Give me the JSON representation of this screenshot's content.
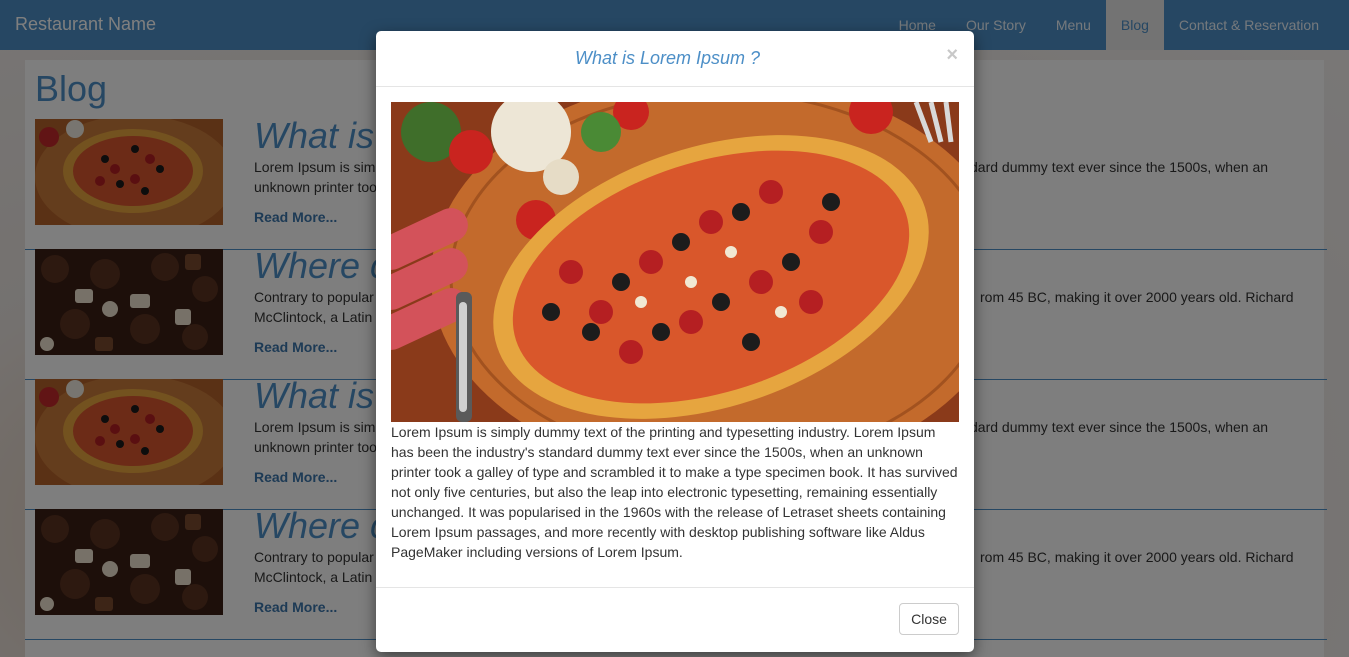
{
  "navbar": {
    "brand": "Restaurant Name",
    "items": [
      {
        "label": "Home",
        "active": false
      },
      {
        "label": "Our Story",
        "active": false
      },
      {
        "label": "Menu",
        "active": false
      },
      {
        "label": "Blog",
        "active": true
      },
      {
        "label": "Contact & Reservation",
        "active": false
      }
    ]
  },
  "page": {
    "title": "Blog",
    "posts": [
      {
        "image": "pizza-image",
        "title": "What is",
        "excerpt_left": "Lorem Ipsum is sim",
        "excerpt_right": "dard dummy text ever since the 1500s, when an",
        "excerpt_line2": "unknown printer too",
        "read_more": "Read More..."
      },
      {
        "image": "chocolates-image",
        "title": "Where c",
        "excerpt_left": "Contrary to popular",
        "excerpt_right": "rom 45 BC, making it over 2000 years old. Richard",
        "excerpt_line2": "McClintock, a Latin",
        "read_more": "Read More..."
      },
      {
        "image": "pizza-image",
        "title": "What is",
        "excerpt_left": "Lorem Ipsum is sim",
        "excerpt_right": "dard dummy text ever since the 1500s, when an",
        "excerpt_line2": "unknown printer too",
        "read_more": "Read More..."
      },
      {
        "image": "chocolates-image",
        "title": "Where c",
        "excerpt_left": "Contrary to popular",
        "excerpt_right": "rom 45 BC, making it over 2000 years old. Richard",
        "excerpt_line2": "McClintock, a Latin",
        "read_more": "Read More..."
      }
    ]
  },
  "modal": {
    "title": "What is Lorem Ipsum ?",
    "close_symbol": "×",
    "image": "pizza-image",
    "body": "Lorem Ipsum is simply dummy text of the printing and typesetting industry. Lorem Ipsum has been the industry's standard dummy text ever since the 1500s, when an unknown printer took a galley of type and scrambled it to make a type specimen book. It has survived not only five centuries, but also the leap into electronic typesetting, remaining essentially unchanged. It was popularised in the 1960s with the release of Letraset sheets containing Lorem Ipsum passages, and more recently with desktop publishing software like Aldus PageMaker including versions of Lorem Ipsum.",
    "close_button": "Close"
  },
  "colors": {
    "primary": "#4d8fc7",
    "link": "#3a75ab",
    "backdrop": "rgba(0,0,0,0.5)"
  }
}
